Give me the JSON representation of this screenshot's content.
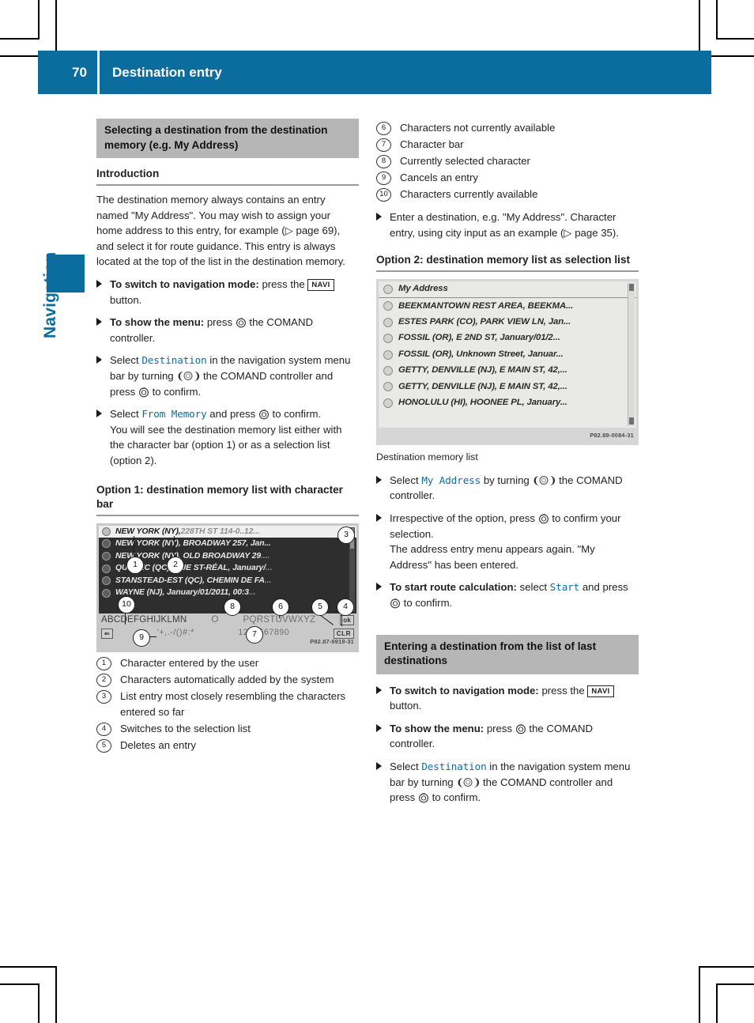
{
  "header": {
    "page_number": "70",
    "title": "Destination entry",
    "accent_color": "#0b6d9d"
  },
  "sidebar": {
    "chapter": "Navigation"
  },
  "left_column": {
    "band_title": "Selecting a destination from the destination memory (e.g. My Address)",
    "subhead": "Introduction",
    "intro": "The destination memory always contains an entry named \"My Address\". You may wish to assign your home address to this entry, for example (▷ page 69), and select it for route guidance. This entry is always located at the top of the list in the destination memory.",
    "steps": [
      {
        "bold": "To switch to navigation mode:",
        "pre": " press the ",
        "key": "NAVI",
        "post": " button."
      },
      {
        "bold": "To show the menu:",
        "pre": " press ",
        "icon": "comand-press-icon",
        "post": " the COMAND controller."
      },
      {
        "pre": "Select ",
        "cmd": "Destination",
        "mid": " in the navigation system menu bar by turning ",
        "icon": "comand-turn-icon",
        "mid2": " the COMAND controller and press ",
        "icon2": "comand-press-icon",
        "post": " to confirm."
      },
      {
        "pre": "Select ",
        "cmd": "From Memory",
        "mid": " and press ",
        "icon": "comand-press-icon",
        "post": " to confirm.",
        "extra": "You will see the destination memory list either with the character bar (option 1) or as a selection list (option 2)."
      }
    ],
    "option1_heading": "Option 1: destination memory list with character bar",
    "figure1": {
      "code": "P82.87-6919-31",
      "rows": [
        {
          "text": "NEW YORK (NY),",
          "dim": " 228TH ST 114-0..12...",
          "selected": true
        },
        {
          "text": "NEW YORK (NY), BROADWAY 257, Jan...",
          "dim": "",
          "selected": false
        },
        {
          "text": "NEW YORK (NY), OLD BROADWAY 29",
          "dim": "....",
          "selected": false
        },
        {
          "text": "QUÉBEC (QC), RUE ST-RÉAL, January/",
          "dim": "...",
          "selected": false
        },
        {
          "text": "STANSTEAD-EST (QC), CHEMIN DE FA",
          "dim": "...",
          "selected": false
        },
        {
          "text": "WAYNE (NJ), January/01/2011, 00:3",
          "dim": "...",
          "selected": false
        }
      ],
      "alpha_available": "ABCDEFGHIJKLMN",
      "alpha_selected": "O",
      "alpha_unavailable": "PQRSTUVWXYZ",
      "ok_key": "ok",
      "symbols": "'+,.-/()#:*",
      "digits": "1234567890",
      "clear_key": "CLR",
      "back_key": "back-arrow-icon",
      "callouts": [
        "1",
        "2",
        "3",
        "4",
        "5",
        "6",
        "7",
        "8",
        "9",
        "10"
      ]
    },
    "legend": [
      {
        "num": "1",
        "text": "Character entered by the user"
      },
      {
        "num": "2",
        "text": "Characters automatically added by the system"
      },
      {
        "num": "3",
        "text": "List entry most closely resembling the characters entered so far"
      },
      {
        "num": "4",
        "text": "Switches to the selection list"
      },
      {
        "num": "5",
        "text": "Deletes an entry"
      }
    ]
  },
  "right_column": {
    "legend": [
      {
        "num": "6",
        "text": "Characters not currently available"
      },
      {
        "num": "7",
        "text": "Character bar"
      },
      {
        "num": "8",
        "text": "Currently selected character"
      },
      {
        "num": "9",
        "text": "Cancels an entry"
      },
      {
        "num": "10",
        "text": "Characters currently available"
      }
    ],
    "step_enter": "Enter a destination, e.g. \"My Address\". Character entry, using city input as an example (▷ page 35).",
    "option2_heading": "Option 2: destination memory list as selection list",
    "figure2": {
      "code": "P82.89-0084-31",
      "caption": "Destination memory list",
      "rows": [
        "My Address",
        "BEEKMANTOWN REST AREA, BEEKMA...",
        "ESTES PARK (CO), PARK VIEW LN, Jan...",
        "FOSSIL (OR), E 2ND ST, January/01/2...",
        "FOSSIL (OR), Unknown Street, Januar...",
        "GETTY, DENVILLE (NJ), E MAIN ST, 42,...",
        "GETTY, DENVILLE (NJ), E MAIN ST, 42,...",
        "HONOLULU (HI), HOONEE PL, January..."
      ]
    },
    "steps": [
      {
        "pre": "Select ",
        "cmd": "My Address",
        "mid": " by turning ",
        "icon": "comand-turn-icon",
        "post": " the COMAND controller."
      },
      {
        "pre": "Irrespective of the option, press ",
        "icon": "comand-press-icon",
        "post": " to confirm your selection.",
        "extra": "The address entry menu appears again. \"My Address\" has been entered."
      },
      {
        "bold": "To start route calculation:",
        "pre": " select ",
        "cmd": "Start",
        "mid": " and press ",
        "icon": "comand-press-icon",
        "post": " to confirm."
      }
    ],
    "band_title": "Entering a destination from the list of last destinations",
    "steps2": [
      {
        "bold": "To switch to navigation mode:",
        "pre": " press the ",
        "key": "NAVI",
        "post": " button."
      },
      {
        "bold": "To show the menu:",
        "pre": " press ",
        "icon": "comand-press-icon",
        "post": " the COMAND controller."
      },
      {
        "pre": "Select ",
        "cmd": "Destination",
        "mid": " in the navigation system menu bar by turning ",
        "icon": "comand-turn-icon",
        "mid2": " the COMAND controller and press ",
        "icon2": "comand-press-icon",
        "post": " to confirm."
      }
    ]
  }
}
